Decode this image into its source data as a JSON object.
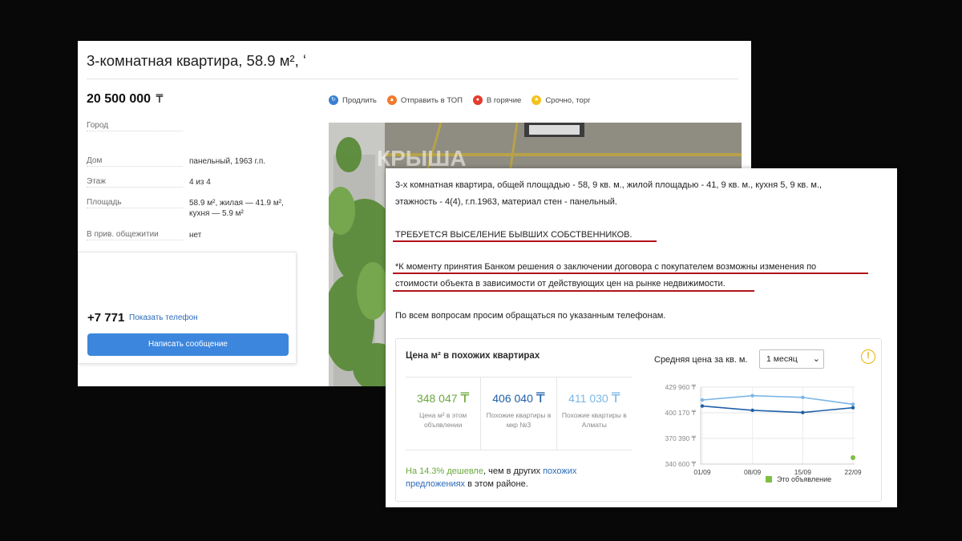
{
  "listing": {
    "title": "3-комнатная квартира, 58.9 м², ʻ",
    "price": "20 500 000",
    "currency": "₸",
    "params": [
      {
        "label": "Город",
        "value": ""
      },
      {
        "label": "Дом",
        "value": "панельный, 1963 г.п."
      },
      {
        "label": "Этаж",
        "value": "4 из 4"
      },
      {
        "label": "Площадь",
        "value": "58.9 м², жилая — 41.9 м², кухня — 5.9 м²"
      },
      {
        "label": "В прив. общежитии",
        "value": "нет"
      }
    ],
    "phone": "+7 771",
    "show_phone": "Показать телефон",
    "message_button": "Написать сообщение",
    "actions": [
      {
        "label": "Продлить",
        "icon": "refresh-icon",
        "color": "#3a7fd0"
      },
      {
        "label": "Отправить в ТОП",
        "icon": "arrow-up-icon",
        "color": "#f07a2c"
      },
      {
        "label": "В горячие",
        "icon": "flame-icon",
        "color": "#e23b2e"
      },
      {
        "label": "Срочно, торг",
        "icon": "star-icon",
        "color": "#f2c21b"
      }
    ],
    "photo_watermark": "КРЫША"
  },
  "description": {
    "para1_line1": "3-х комнатная квартира, общей площадью - 58, 9 кв. м., жилой площадью - 41, 9 кв. м., кухня 5, 9 кв. м.,",
    "para1_line2": "этажность - 4(4), г.п.1963, материал стен - панельный.",
    "eviction": "ТРЕБУЕТСЯ ВЫСЕЛЕНИЕ БЫВШИХ СОБСТВЕННИКОВ.",
    "note_line1": "*К моменту принятия Банком решения о заключении договора с покупателем возможны изменения по",
    "note_line2": "стоимости объекта в зависимости от действующих цен на рынке недвижимости.",
    "contact": "По всем вопросам просим обращаться по указанным телефонам."
  },
  "stats": {
    "title": "Цена м² в похожих квартирах",
    "boxes": [
      {
        "value": "348 047",
        "currency": "₸",
        "label": "Цена м² в этом объявлении",
        "color": "#6aa83c"
      },
      {
        "value": "406 040",
        "currency": "₸",
        "label": "Похожие квартиры в мкр №3",
        "color": "#1f5fa8"
      },
      {
        "value": "411 030",
        "currency": "₸",
        "label": "Похожие квартиры в Алматы",
        "color": "#7ab6e6"
      }
    ],
    "note_pct": "На 14.3% дешевле",
    "note_mid": ", чем в других ",
    "note_link": "похожих предложениях",
    "note_end": " в этом районе.",
    "avg_label": "Средняя цена за кв. м.",
    "period": "1 месяц",
    "warning": "!",
    "legend": "Это объявление"
  },
  "chart_data": {
    "type": "line",
    "categories": [
      "01/09",
      "08/09",
      "15/09",
      "22/09"
    ],
    "series": [
      {
        "values": [
          415000,
          420000,
          418000,
          410000
        ],
        "color": "#7ab6e6"
      },
      {
        "values": [
          408000,
          403000,
          400500,
          406040
        ],
        "color": "#1f5fa8"
      }
    ],
    "point": {
      "x": "22/09",
      "value": 348047,
      "color": "#7cbf43"
    },
    "yticks": [
      "429 960 ₸",
      "400 170 ₸",
      "370 390 ₸",
      "340 600 ₸"
    ],
    "ylim": [
      340600,
      429960
    ],
    "grid": true
  }
}
